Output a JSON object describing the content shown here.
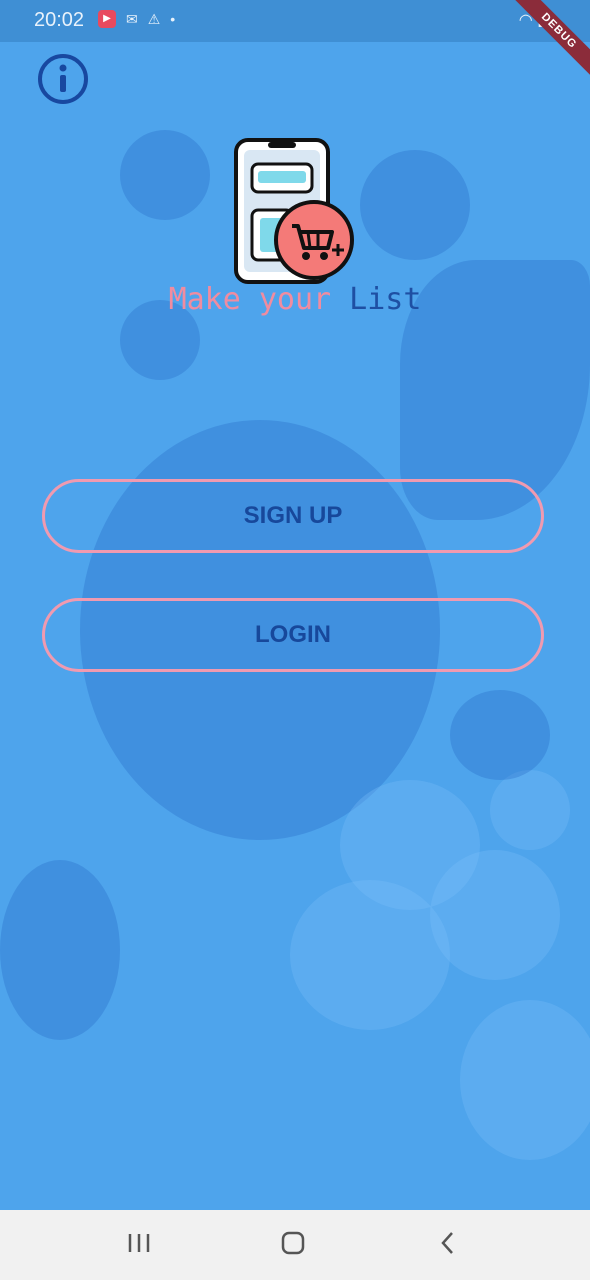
{
  "status_bar": {
    "time": "20:02",
    "debug_label": "DEBUG",
    "icons": [
      "youtube-icon",
      "notification-icon",
      "warning-icon",
      "dot-icon",
      "wifi-icon",
      "signal-icon",
      "battery-icon"
    ]
  },
  "header": {
    "info_icon": "info-icon"
  },
  "app": {
    "title_part1": "Make your",
    "title_part2": " List",
    "logo_icon": "phone-cart-icon"
  },
  "buttons": {
    "signup_label": "SIGN UP",
    "login_label": "LOGIN"
  },
  "navigation": {
    "recent_icon": "recent-apps-icon",
    "home_icon": "home-icon",
    "back_icon": "back-icon"
  },
  "colors": {
    "background": "#4ea4ec",
    "accent_pink": "#f09ab0",
    "title_pink": "#f08ca0",
    "title_blue": "#1e4fa3",
    "button_text": "#17489b",
    "nav_bar": "#f1f1f1"
  }
}
